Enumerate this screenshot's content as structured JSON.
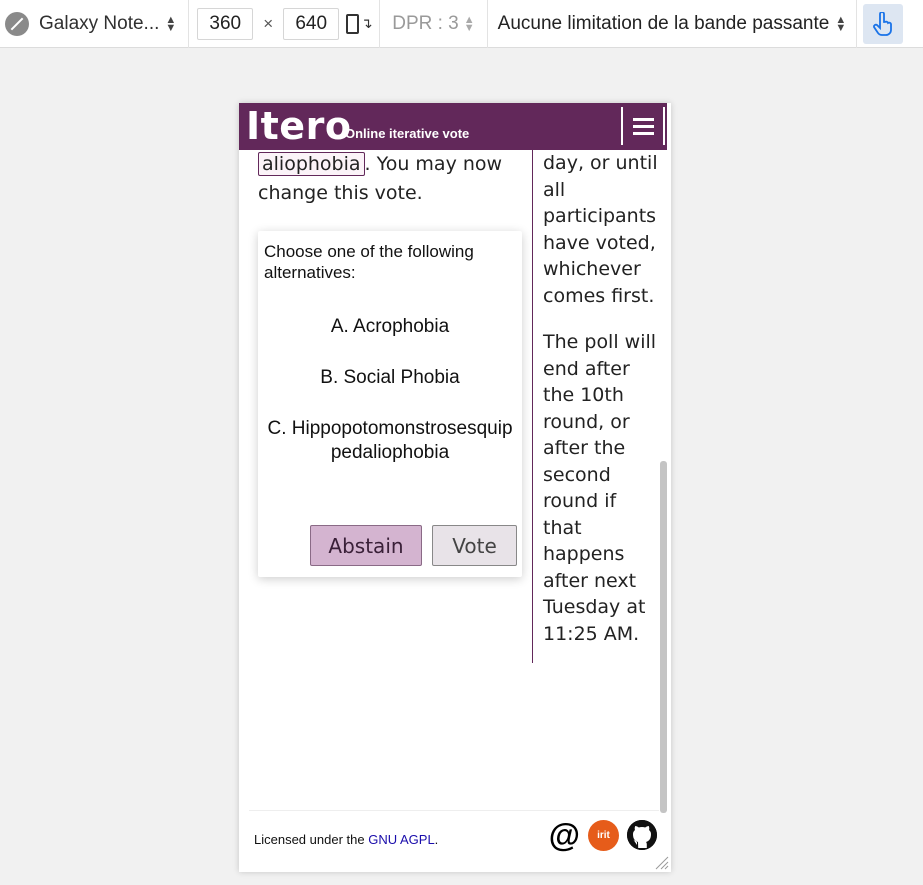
{
  "toolbar": {
    "device": "Galaxy Note...",
    "width": "360",
    "height": "640",
    "times": "×",
    "dpr": "DPR : 3",
    "throttling": "Aucune limitation de la bande passante"
  },
  "header": {
    "brand": "Itero",
    "tagline": "Online iterative vote"
  },
  "main": {
    "chosen_alternative": "aliophobia",
    "vote_text_after": ". You may now change this vote.",
    "prompt": "Choose one of the following alternatives:",
    "alternatives": [
      "A. Acrophobia",
      "B. Social Phobia",
      "C. Hippopotomonstrosesquippedaliophobia"
    ],
    "abstain_label": "Abstain",
    "vote_label": "Vote"
  },
  "side": {
    "paragraph1": "day, or until all participants have voted, whichever comes first.",
    "paragraph2": "The poll will end after the 10th round, or after the second round if that happens after next Tuesday at 11:25 AM."
  },
  "footer": {
    "license_prefix": "Licensed under the ",
    "license_link": "GNU AGPL",
    "license_suffix": ".",
    "irit_label": "irit"
  },
  "colors": {
    "brand": "#62285a",
    "abstain_bg": "#d4b4d0",
    "vote_bg": "#e8e3e8"
  }
}
